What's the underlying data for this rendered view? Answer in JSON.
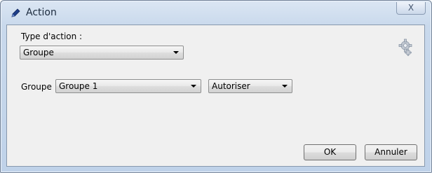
{
  "window": {
    "title": "Action",
    "close_symbol": "X"
  },
  "form": {
    "action_type_label": "Type d'action :",
    "action_type_value": "Groupe",
    "group_label": "Groupe",
    "group_value": "Groupe 1",
    "permission_value": "Autoriser"
  },
  "buttons": {
    "ok_label": "OK",
    "cancel_label": "Annuler"
  },
  "icons": {
    "title": "pen-icon",
    "settings": "gear-icon"
  },
  "colors": {
    "title_bar": "#c9d9ec",
    "client_area": "#f0f0f0"
  }
}
